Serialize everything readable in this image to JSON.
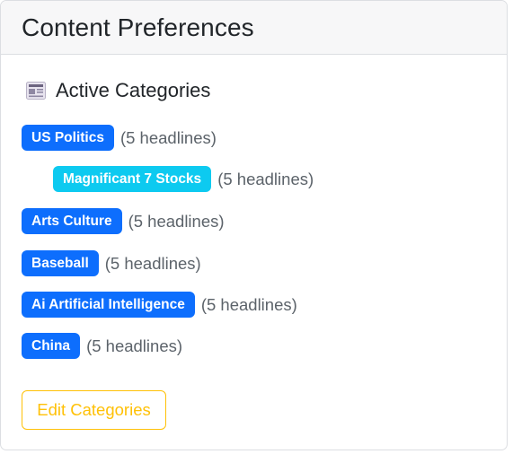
{
  "header": {
    "title": "Content Preferences"
  },
  "section": {
    "title": "Active Categories",
    "icon": "newspaper-icon"
  },
  "categories": [
    {
      "name": "US Politics",
      "count_text": "(5 headlines)",
      "level": 0,
      "color": "#0d6efd"
    },
    {
      "name": "Magnificant 7 Stocks",
      "count_text": "(5 headlines)",
      "level": 1,
      "color": "#0dcaf0"
    },
    {
      "name": "Arts Culture",
      "count_text": "(5 headlines)",
      "level": 0,
      "color": "#0d6efd"
    },
    {
      "name": "Baseball",
      "count_text": "(5 headlines)",
      "level": 0,
      "color": "#0d6efd"
    },
    {
      "name": "Ai Artificial Intelligence",
      "count_text": "(5 headlines)",
      "level": 0,
      "color": "#0d6efd"
    },
    {
      "name": "China",
      "count_text": "(5 headlines)",
      "level": 0,
      "color": "#0d6efd"
    }
  ],
  "actions": {
    "edit_label": "Edit Categories",
    "edit_color": "#ffc107"
  }
}
